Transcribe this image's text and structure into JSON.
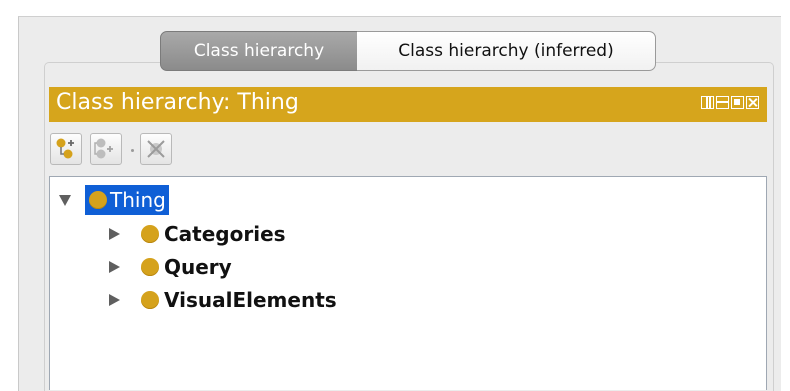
{
  "tabs": [
    {
      "label": "Class hierarchy",
      "active": true
    },
    {
      "label": "Class hierarchy (inferred)",
      "active": false
    }
  ],
  "view": {
    "title": "Class hierarchy: Thing",
    "accent_color": "#d6a51c",
    "title_controls": [
      "split-vertical-icon",
      "split-horizontal-icon",
      "maximize-icon",
      "close-icon"
    ]
  },
  "toolbar": {
    "buttons": [
      {
        "icon": "add-subclass-icon"
      },
      {
        "icon": "add-sibling-class-icon"
      },
      {
        "icon": "delete-class-icon"
      }
    ]
  },
  "tree": {
    "root": {
      "label": "Thing",
      "selected": true,
      "expanded": true
    },
    "children": [
      {
        "label": "Categories",
        "expanded": false
      },
      {
        "label": "Query",
        "expanded": false
      },
      {
        "label": "VisualElements",
        "expanded": false
      }
    ],
    "selection_color": "#0f5fd6",
    "class_color": "#d5a21c"
  }
}
